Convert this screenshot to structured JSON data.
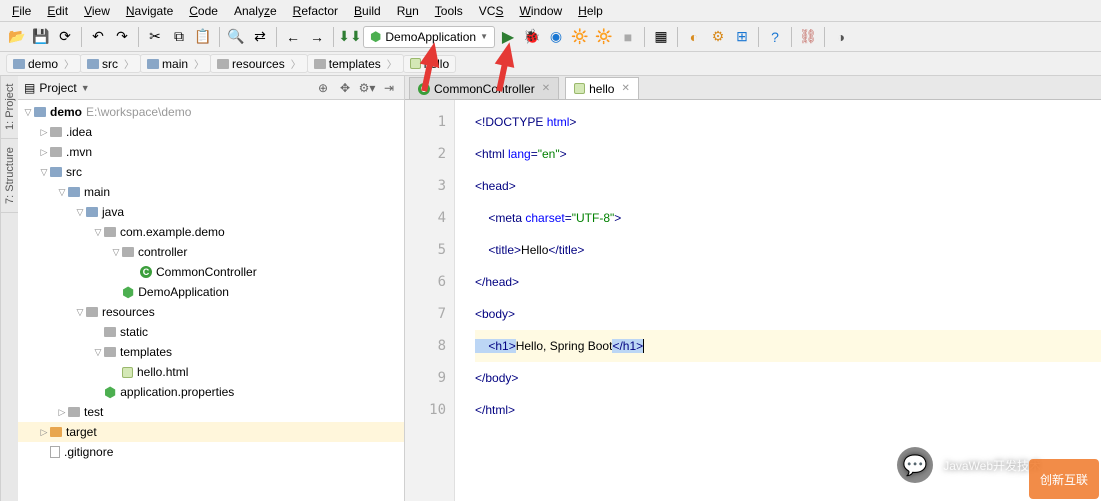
{
  "menu": [
    "File",
    "Edit",
    "View",
    "Navigate",
    "Code",
    "Analyze",
    "Refactor",
    "Build",
    "Run",
    "Tools",
    "VCS",
    "Window",
    "Help"
  ],
  "run_config": "DemoApplication",
  "breadcrumb": [
    {
      "icon": "folder-blue",
      "label": "demo"
    },
    {
      "icon": "folder-blue",
      "label": "src"
    },
    {
      "icon": "folder-blue",
      "label": "main"
    },
    {
      "icon": "folder-gray",
      "label": "resources"
    },
    {
      "icon": "folder-gray",
      "label": "templates"
    },
    {
      "icon": "html",
      "label": "hello"
    }
  ],
  "project_panel_title": "Project",
  "tree": {
    "root": {
      "label": "demo",
      "path": "E:\\workspace\\demo"
    },
    "idea": ".idea",
    "mvn": ".mvn",
    "src": "src",
    "main": "main",
    "java": "java",
    "pkg": "com.example.demo",
    "controller_folder": "controller",
    "controller_class": "CommonController",
    "app_class": "DemoApplication",
    "resources": "resources",
    "static": "static",
    "templates": "templates",
    "hello_html": "hello.html",
    "app_props": "application.properties",
    "test": "test",
    "target": "target",
    "gitignore": ".gitignore"
  },
  "tabs": [
    {
      "icon": "class",
      "label": "CommonController",
      "active": false
    },
    {
      "icon": "html",
      "label": "hello",
      "active": true
    }
  ],
  "code": {
    "l1": {
      "a": "<!DOCTYPE ",
      "b": "html",
      "c": ">"
    },
    "l2": {
      "a": "<html ",
      "b": "lang",
      "c": "=",
      "d": "\"en\"",
      "e": ">"
    },
    "l3": "<head>",
    "l4": {
      "a": "    <meta ",
      "b": "charset",
      "c": "=",
      "d": "\"UTF-8\"",
      "e": ">"
    },
    "l5": {
      "a": "    <title>",
      "b": "Hello",
      "c": "</title>"
    },
    "l6": "</head>",
    "l7": "<body>",
    "l8": {
      "a": "    <h1>",
      "b": "Hello, Spring Boot",
      "c": "</h1>"
    },
    "l9": "</body>",
    "l10": "</html>"
  },
  "side": {
    "project": "1: Project",
    "structure": "7: Structure"
  },
  "watermark": "JavaWeb开发技术",
  "corner": "创新互联"
}
